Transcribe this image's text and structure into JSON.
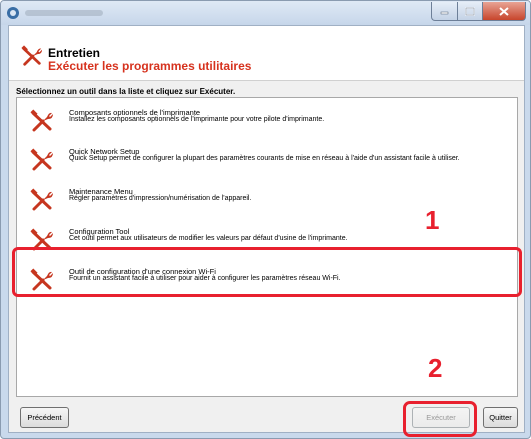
{
  "window": {
    "header": {
      "title": "Entretien",
      "subtitle": "Exécuter les programmes utilitaires"
    },
    "instruction": "Sélectionnez un outil dans la liste et cliquez sur Exécuter.",
    "tools": [
      {
        "title": "Composants optionnels de l'imprimante",
        "description": "Installez les composants optionnels de l'imprimante pour votre pilote d'imprimante.",
        "icon": "tools-icon"
      },
      {
        "title": "Quick Network Setup",
        "description": "Quick Setup permet de configurer la plupart des paramètres courants de mise en réseau à l'aide d'un assistant facile à utiliser.",
        "icon": "tools-icon"
      },
      {
        "title": "Maintenance Menu",
        "description": "Régler paramètres d'impression/numérisation de l'appareil.",
        "icon": "tools-icon"
      },
      {
        "title": "Configuration Tool",
        "description": "Cet outil permet aux utilisateurs de modifier les valeurs par défaut d'usine de l'imprimante.",
        "icon": "tools-icon"
      },
      {
        "title": "Outil de configuration d'une connexion Wi-Fi",
        "description": "Fournit un assistant facile à utiliser pour aider à configurer les paramètres réseau Wi-Fi.",
        "icon": "tools-icon"
      }
    ],
    "buttons": {
      "previous": "Précédent",
      "execute": "Exécuter",
      "quit": "Quitter"
    },
    "callouts": {
      "step1": "1",
      "step2": "2"
    },
    "colors": {
      "accent": "#d6321e",
      "callout": "#e8202e"
    }
  }
}
